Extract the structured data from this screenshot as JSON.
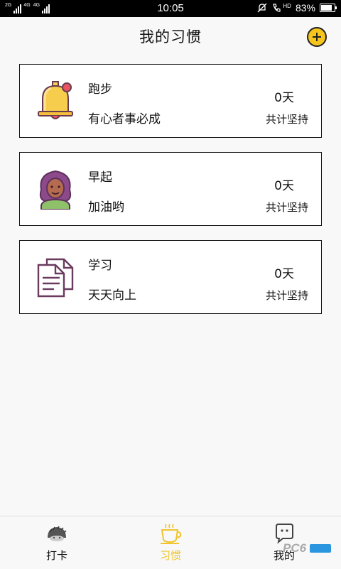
{
  "statusbar": {
    "network_tags": [
      "2G",
      "4G",
      "4G"
    ],
    "time": "10:05",
    "volte": "HD",
    "battery_text": "83%",
    "battery_level": 0.83
  },
  "header": {
    "title": "我的习惯"
  },
  "habits": [
    {
      "name": "跑步",
      "motto": "有心者事必成",
      "days": "0天",
      "total_label": "共计坚持",
      "icon": "bell-icon"
    },
    {
      "name": "早起",
      "motto": "加油哟",
      "days": "0天",
      "total_label": "共计坚持",
      "icon": "person-avatar-icon"
    },
    {
      "name": "学习",
      "motto": "天天向上",
      "days": "0天",
      "total_label": "共计坚持",
      "icon": "documents-icon"
    }
  ],
  "bottom_nav": [
    {
      "label": "打卡",
      "icon": "hedgehog-icon",
      "active": false
    },
    {
      "label": "习惯",
      "icon": "coffee-cup-icon",
      "active": true
    },
    {
      "label": "我的",
      "icon": "chat-bubble-face-icon",
      "active": false
    }
  ],
  "colors": {
    "accent": "#f0c52e",
    "add_button": "#f6c51c"
  }
}
